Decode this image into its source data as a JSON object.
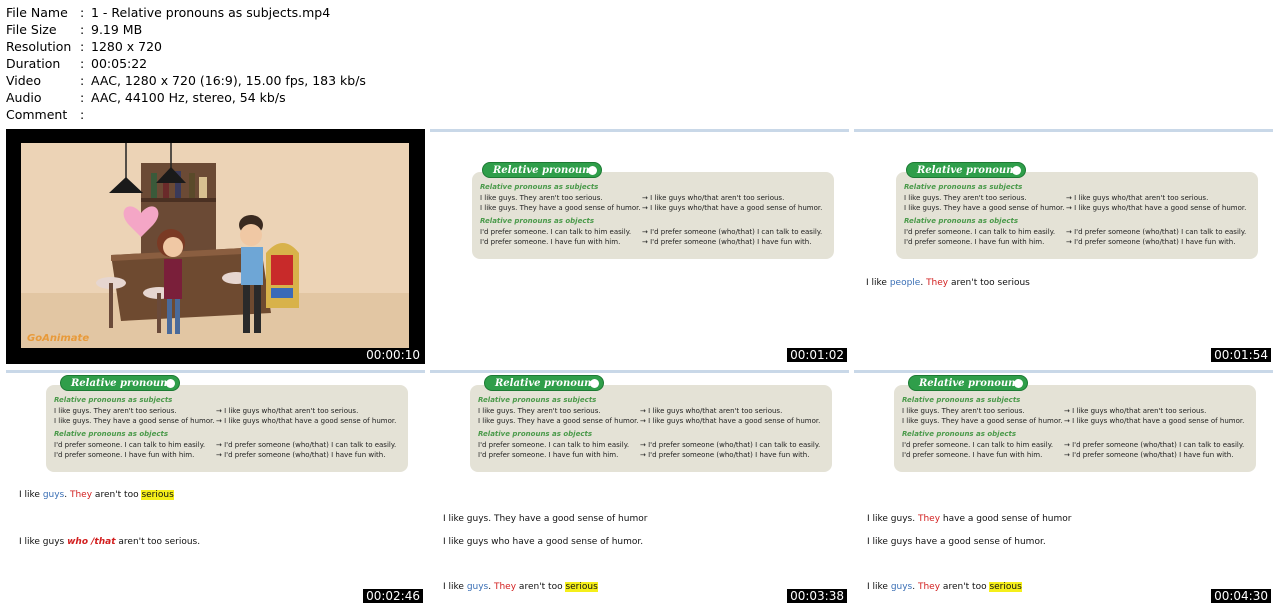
{
  "file_info": [
    {
      "key": "File Name",
      "value": "1 - Relative pronouns as subjects.mp4"
    },
    {
      "key": "File Size",
      "value": "9.19 MB"
    },
    {
      "key": "Resolution",
      "value": "1280 x 720"
    },
    {
      "key": "Duration",
      "value": "00:05:22"
    },
    {
      "key": "Video",
      "value": "AAC, 1280 x 720 (16:9), 15.00 fps, 183 kb/s"
    },
    {
      "key": "Audio",
      "value": "AAC, 44100 Hz, stereo, 54 kb/s"
    },
    {
      "key": "Comment",
      "value": ""
    }
  ],
  "separator": ":",
  "card": {
    "tab": "Relative pronouns",
    "sec_subjects": "Relative pronouns as subjects",
    "s1_left": "I like guys. They aren't too serious.",
    "s1_right": "→ I like guys who/that aren't too serious.",
    "s2_left": "I like guys. They have a good sense of humor.",
    "s2_right": "→ I like guys who/that have a good sense of humor.",
    "sec_objects": "Relative pronouns as objects",
    "o1_left": "I'd prefer someone. I can talk to him easily.",
    "o1_right": "→ I'd prefer someone (who/that) I can talk to easily.",
    "o2_left": "I'd prefer someone. I have fun with him.",
    "o2_right": "→ I'd prefer someone (who/that) I have fun with."
  },
  "thumbnails": [
    {
      "timestamp": "00:00:10",
      "logo": "GoAnimate"
    },
    {
      "timestamp": "00:01:02"
    },
    {
      "timestamp": "00:01:54",
      "note": {
        "a": "I like ",
        "b": "people",
        "c": ". ",
        "d": "They",
        "e": " aren't too serious"
      }
    },
    {
      "timestamp": "00:02:46",
      "note1": {
        "a": "I like ",
        "b": "guys",
        "c": ". ",
        "d": "They",
        "e": " aren't too ",
        "f": "serious"
      },
      "note2": {
        "a": "I like guys ",
        "b": "who /that",
        "c": " aren't too serious."
      }
    },
    {
      "timestamp": "00:03:38",
      "l1": "I like guys. They have a good sense of humor",
      "l2": "I like guys who have a good sense of humor.",
      "l3": {
        "a": "I like ",
        "b": "guys",
        "c": ". ",
        "d": "They",
        "e": " aren't too ",
        "f": "serious"
      }
    },
    {
      "timestamp": "00:04:30",
      "l1": {
        "a": "I like guys. ",
        "b": "They",
        "c": " have a good sense of humor"
      },
      "l2": "I like guys have a good sense of humor.",
      "l3": {
        "a": "I like ",
        "b": "guys",
        "c": ". ",
        "d": "They",
        "e": " aren't too ",
        "f": "serious"
      }
    }
  ]
}
